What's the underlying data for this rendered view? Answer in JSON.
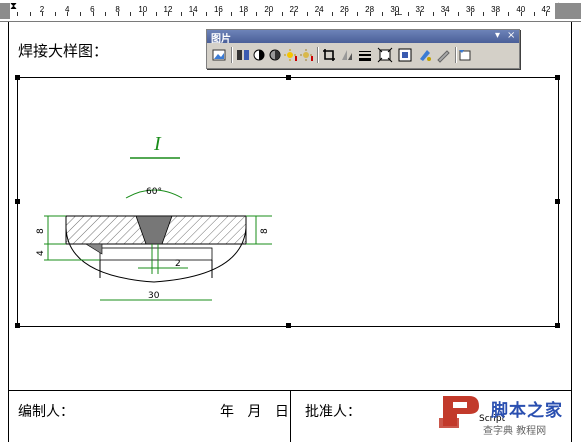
{
  "ruler": {
    "labels": [
      "2",
      "4",
      "6",
      "8",
      "10",
      "12",
      "14",
      "16",
      "18",
      "20",
      "22",
      "24",
      "26",
      "28",
      "30",
      "32",
      "34",
      "36",
      "38",
      "40",
      "42"
    ]
  },
  "document": {
    "title": "焊接大样图：",
    "footer": {
      "edit_label": "编制人：",
      "date_label": "年 月 日",
      "approve_label": "批准人："
    }
  },
  "drawing": {
    "detail_label": "I",
    "angle_label": "60°",
    "dim_left_top": "8",
    "dim_left_bottom": "4",
    "dim_right": "8",
    "dim_gap": "2",
    "dim_width": "30"
  },
  "toolbar": {
    "title": "图片",
    "buttons": [
      {
        "name": "insert-picture-icon"
      },
      {
        "name": "color-icon"
      },
      {
        "name": "more-contrast-icon"
      },
      {
        "name": "less-contrast-icon"
      },
      {
        "name": "more-brightness-icon"
      },
      {
        "name": "less-brightness-icon"
      },
      {
        "name": "crop-icon"
      },
      {
        "name": "rotate-icon"
      },
      {
        "name": "line-style-icon"
      },
      {
        "name": "compress-icon"
      },
      {
        "name": "text-wrapping-icon"
      },
      {
        "name": "format-picture-icon"
      },
      {
        "name": "set-transparent-color-icon"
      },
      {
        "name": "reset-picture-icon"
      }
    ],
    "dropdown_glyph": "▾",
    "close_glyph": "×"
  },
  "watermark": {
    "site_name": "脚本之家",
    "site_sub": "查字典 教程网",
    "side_text": "Script"
  },
  "colors": {
    "toolbar_title": "#4a5f98",
    "drawing_green": "#1a8c1a",
    "drawing_gray": "#888888",
    "watermark_blue": "#2a4fb0",
    "watermark_red": "#c23a2b"
  }
}
